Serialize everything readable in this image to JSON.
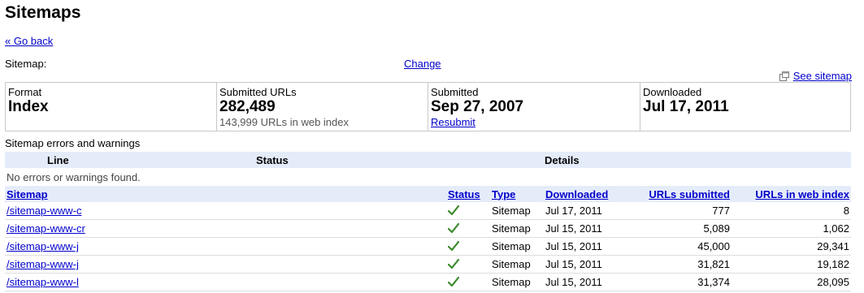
{
  "header": {
    "title": "Sitemaps",
    "go_back": "« Go back",
    "sitemap_label": "Sitemap:",
    "change_link": "Change",
    "see_sitemap": "See sitemap"
  },
  "summary": {
    "format_label": "Format",
    "format_value": "Index",
    "submitted_urls_label": "Submitted URLs",
    "submitted_urls_value": "282,489",
    "submitted_urls_sub": "143,999 URLs in web index",
    "submitted_label": "Submitted",
    "submitted_value": "Sep 27, 2007",
    "resubmit_link": "Resubmit",
    "downloaded_label": "Downloaded",
    "downloaded_value": "Jul 17, 2011"
  },
  "errors": {
    "title": "Sitemap errors and warnings",
    "columns": [
      "Line",
      "Status",
      "Details"
    ],
    "empty_message": "No errors or warnings found."
  },
  "table": {
    "columns": {
      "sitemap": "Sitemap",
      "status": "Status",
      "type": "Type",
      "downloaded": "Downloaded",
      "urls_submitted": "URLs submitted",
      "urls_in_index": "URLs in web index"
    },
    "status_icon": "green-check-icon",
    "rows": [
      {
        "sitemap": "/sitemap-www-c",
        "type": "Sitemap",
        "downloaded": "Jul 17, 2011",
        "submitted": "777",
        "indexed": "8"
      },
      {
        "sitemap": "/sitemap-www-cr",
        "type": "Sitemap",
        "downloaded": "Jul 15, 2011",
        "submitted": "5,089",
        "indexed": "1,062"
      },
      {
        "sitemap": "/sitemap-www-j",
        "type": "Sitemap",
        "downloaded": "Jul 15, 2011",
        "submitted": "45,000",
        "indexed": "29,341"
      },
      {
        "sitemap": "/sitemap-www-j",
        "type": "Sitemap",
        "downloaded": "Jul 15, 2011",
        "submitted": "31,821",
        "indexed": "19,182"
      },
      {
        "sitemap": "/sitemap-www-l",
        "type": "Sitemap",
        "downloaded": "Jul 15, 2011",
        "submitted": "31,374",
        "indexed": "28,095"
      }
    ]
  },
  "colors": {
    "link": "#0000cc",
    "header_bg": "#e5ecf9",
    "check_green": "#3a8a2a"
  }
}
